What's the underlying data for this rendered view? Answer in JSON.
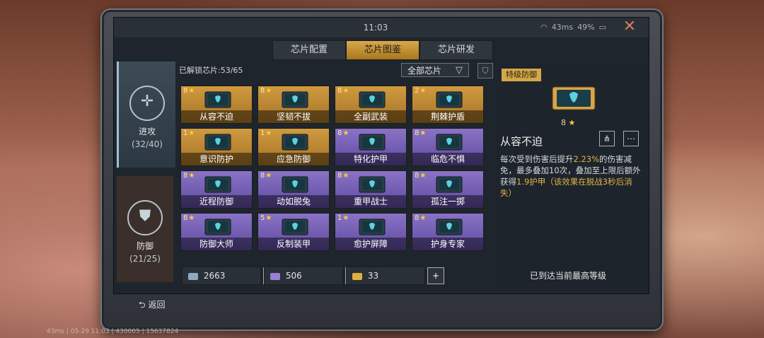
{
  "topbar": {
    "time": "11:03",
    "ping": "43ms",
    "battery": "49%"
  },
  "tabs": [
    {
      "label": "芯片配置"
    },
    {
      "label": "芯片图鉴"
    },
    {
      "label": "芯片研发"
    }
  ],
  "sidebar": {
    "attack": {
      "name": "进攻",
      "count": "(32/40)"
    },
    "defense": {
      "name": "防御",
      "count": "(21/25)"
    }
  },
  "unlock_text": "已解锁芯片:53/65",
  "filter": {
    "label": "全部芯片"
  },
  "chips": [
    {
      "level": "8",
      "name": "从容不迫",
      "rarity": "gold"
    },
    {
      "level": "8",
      "name": "坚韧不拔",
      "rarity": "gold"
    },
    {
      "level": "8",
      "name": "全副武装",
      "rarity": "gold"
    },
    {
      "level": "2",
      "name": "荆棘护盾",
      "rarity": "gold"
    },
    {
      "level": "1",
      "name": "意识防护",
      "rarity": "gold"
    },
    {
      "level": "1",
      "name": "应急防御",
      "rarity": "gold"
    },
    {
      "level": "8",
      "name": "特化护甲",
      "rarity": "purple"
    },
    {
      "level": "8",
      "name": "临危不惧",
      "rarity": "purple"
    },
    {
      "level": "8",
      "name": "近程防御",
      "rarity": "purple"
    },
    {
      "level": "8",
      "name": "动如脱兔",
      "rarity": "purple"
    },
    {
      "level": "8",
      "name": "重甲战士",
      "rarity": "purple"
    },
    {
      "level": "8",
      "name": "孤注一掷",
      "rarity": "purple"
    },
    {
      "level": "8",
      "name": "防御大师",
      "rarity": "purple"
    },
    {
      "level": "5",
      "name": "反制装甲",
      "rarity": "purple"
    },
    {
      "level": "1",
      "name": "愈护屏障",
      "rarity": "purple"
    },
    {
      "level": "8",
      "name": "护身专家",
      "rarity": "purple"
    }
  ],
  "resources": [
    {
      "value": "2663",
      "color": "#8fa8c0"
    },
    {
      "value": "506",
      "color": "#9a7fd0"
    },
    {
      "value": "33",
      "color": "#e0b040"
    }
  ],
  "detail": {
    "badge": "特级防御",
    "level": "8",
    "name": "从容不迫",
    "desc_a": "每次受到伤害后提升",
    "desc_hl1": "2.23%",
    "desc_b": "的伤害减免，最多叠加10次，叠加至上限后额外获得",
    "desc_hl2": "1.9护甲（该效果在脱战3秒后消失）",
    "max_level": "已到达当前最高等级"
  },
  "back_label": "返回",
  "footer": "43ms | 05-29 11:03 | 430005 | 15637824"
}
